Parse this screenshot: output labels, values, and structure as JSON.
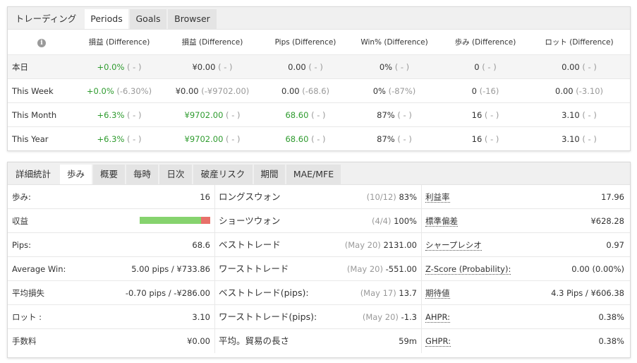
{
  "panel1": {
    "tabs": [
      {
        "label": "トレーディング"
      },
      {
        "label": "Periods"
      },
      {
        "label": "Goals"
      },
      {
        "label": "Browser"
      }
    ],
    "headers": [
      "損益 (Difference)",
      "損益 (Difference)",
      "Pips (Difference)",
      "Win% (Difference)",
      "歩み (Difference)",
      "ロット (Difference)"
    ],
    "rows": [
      {
        "label": "本日",
        "cells": [
          {
            "v": "+0.0%",
            "d": "( - )"
          },
          {
            "v": "¥0.00",
            "d": "( - )"
          },
          {
            "v": "0.00",
            "d": "( - )"
          },
          {
            "v": "0%",
            "d": "( - )"
          },
          {
            "v": "0",
            "d": "( - )"
          },
          {
            "v": "0.00",
            "d": "( - )"
          }
        ]
      },
      {
        "label": "This Week",
        "cells": [
          {
            "v": "+0.0%",
            "d": "(-6.30%)"
          },
          {
            "v": "¥0.00",
            "d": "(-¥9702.00)"
          },
          {
            "v": "0.00",
            "d": "(-68.6)"
          },
          {
            "v": "0%",
            "d": "(-87%)"
          },
          {
            "v": "0",
            "d": "(-16)"
          },
          {
            "v": "0.00",
            "d": "(-3.10)"
          }
        ]
      },
      {
        "label": "This Month",
        "cells": [
          {
            "v": "+6.3%",
            "d": "( - )"
          },
          {
            "v": "¥9702.00",
            "d": "( - )"
          },
          {
            "v": "68.60",
            "d": "( - )"
          },
          {
            "v": "87%",
            "d": "( - )"
          },
          {
            "v": "16",
            "d": "( - )"
          },
          {
            "v": "3.10",
            "d": "( - )"
          }
        ]
      },
      {
        "label": "This Year",
        "cells": [
          {
            "v": "+6.3%",
            "d": "( - )"
          },
          {
            "v": "¥9702.00",
            "d": "( - )"
          },
          {
            "v": "68.60",
            "d": "( - )"
          },
          {
            "v": "87%",
            "d": "( - )"
          },
          {
            "v": "16",
            "d": "( - )"
          },
          {
            "v": "3.10",
            "d": "( - )"
          }
        ]
      }
    ]
  },
  "panel2": {
    "tabs": [
      {
        "label": "詳細統計"
      },
      {
        "label": "歩み"
      },
      {
        "label": "概要"
      },
      {
        "label": "毎時"
      },
      {
        "label": "日次"
      },
      {
        "label": "破産リスク"
      },
      {
        "label": "期間"
      },
      {
        "label": "MAE/MFE"
      }
    ],
    "col1": [
      {
        "label": "歩み:",
        "value": "16"
      },
      {
        "label": "収益",
        "value": ""
      },
      {
        "label": "Pips:",
        "value": "68.6"
      },
      {
        "label": "Average Win:",
        "value": "5.00 pips / ¥733.86"
      },
      {
        "label": "平均損失",
        "value": "-0.70 pips / -¥286.00"
      },
      {
        "label": "ロット :",
        "value": "3.10"
      },
      {
        "label": "手数料",
        "value": "¥0.00"
      }
    ],
    "profit_bar": {
      "win_fraction": 0.87,
      "win_color": "#86d36e",
      "loss_color": "#e8706a"
    },
    "col2": [
      {
        "label": "ロングスウォン",
        "extra": "(10/12)",
        "value": "83%"
      },
      {
        "label": "ショーツウォン",
        "extra": "(4/4)",
        "value": "100%"
      },
      {
        "label": "ベストトレード",
        "extra": "(May 20)",
        "value": "2131.00"
      },
      {
        "label": "ワーストトレード",
        "extra": "(May 20)",
        "value": "-551.00"
      },
      {
        "label": "ベストトレード(pips):",
        "extra": "(May 17)",
        "value": "13.7"
      },
      {
        "label": "ワーストトレード(pips):",
        "extra": "(May 20)",
        "value": "-1.3"
      },
      {
        "label": "平均。貿易の長さ",
        "extra": "",
        "value": "59m"
      }
    ],
    "col3": [
      {
        "label": "利益率",
        "value": "17.96"
      },
      {
        "label": "標準偏差",
        "value": "¥628.28"
      },
      {
        "label": "シャープレシオ",
        "value": "0.97"
      },
      {
        "label": "Z-Score (Probability):",
        "value": "0.00 (0.00%)"
      },
      {
        "label": "期待値",
        "value": "4.3 Pips / ¥606.38"
      },
      {
        "label": "AHPR:",
        "value": "0.38%"
      },
      {
        "label": "GHPR:",
        "value": "0.38%"
      }
    ]
  },
  "colors": {
    "green": "#2e9b2e",
    "muted": "#999999",
    "tab_bg": "#e4e4e4"
  }
}
